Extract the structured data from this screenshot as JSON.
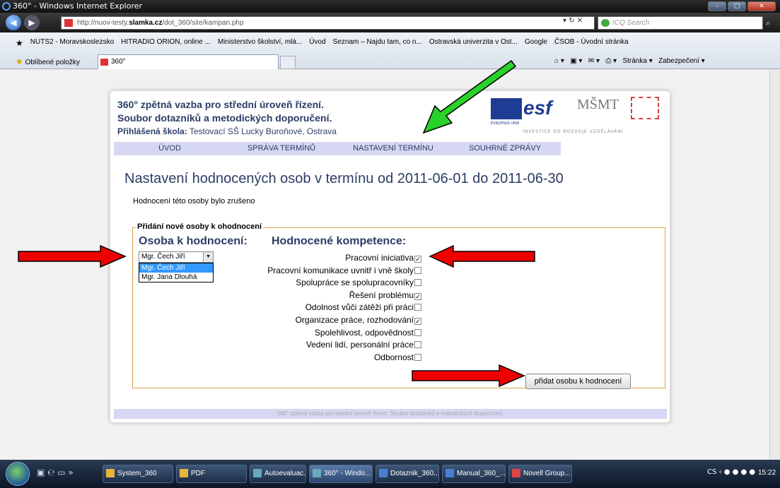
{
  "window": {
    "title": "360° - Windows Internet Explorer"
  },
  "address": {
    "pre": "http://nuov-testy.",
    "domain": "slamka.cz",
    "post": "/dot_360/site/kampan.php"
  },
  "search": {
    "placeholder": "ICQ Search"
  },
  "favorites": {
    "links": [
      "NUTS2 - Moravskoslezsko",
      "HITRADIO ORION, online ...",
      "Ministerstvo školství, mlá...",
      "Úvod",
      "Seznam – Najdu tam, co n...",
      "Ostravská univerzita v Ost...",
      "Google",
      "ČSOB - Úvodní stránka"
    ],
    "oblibene": "Oblíbené položky",
    "tab": "360°",
    "cmd_stranka": "Stránka ▾",
    "cmd_zabezpeceni": "Zabezpečení ▾"
  },
  "header": {
    "line1": "360° zpětná vazba pro střední úroveň řízení.",
    "line2": "Soubor dotazníků a metodických doporučení.",
    "school_label": "Přihlášená škola:",
    "school_name": " Testovací SŠ Lucky Buroňové, Ostrava",
    "eu_text": "EVROPSKÁ UNIE",
    "esf": "esf",
    "msmt": "MŠMT",
    "invest": "INVESTICE DO ROZVOJE VZDĚLÁVÁNÍ"
  },
  "menu": [
    "Úvod",
    "Správa termínů",
    "Nastavení termínu",
    "Souhrné zprávy"
  ],
  "main": {
    "heading": "Nastavení hodnocených osob v termínu od 2011-06-01 do 2011-06-30",
    "message": "Hodnocení této osoby bylo zrušeno",
    "legend": "Přidání nové osoby k ohodnocení",
    "osoba_title": "Osoba k hodnocení:",
    "komp_title": "Hodnocené kompetence:",
    "selected": "Mgr. Čech Jiří",
    "options": [
      "Mgr. Čech Jiří",
      "Mgr. Jana Dlouhá"
    ],
    "competences": [
      {
        "label": "Pracovní iniciativa",
        "checked": true
      },
      {
        "label": "Pracovní komunikace uvnitř i vně školy",
        "checked": false
      },
      {
        "label": "Spolupráce se spolupracovníky",
        "checked": false
      },
      {
        "label": "Řešení problému",
        "checked": true
      },
      {
        "label": "Odolnost vůči zátěži při práci",
        "checked": false
      },
      {
        "label": "Organizace práce, rozhodování",
        "checked": true
      },
      {
        "label": "Spolehlivost, odpovědnost",
        "checked": false
      },
      {
        "label": "Vedení lidí, personální práce",
        "checked": false
      },
      {
        "label": "Odbornost",
        "checked": false
      }
    ],
    "add_button": "přidat osobu k hodnocení",
    "footer": "360° zpětná vazba pro střední úroveň řízení. Soubor dotazníků a metodických doporučení."
  },
  "taskbar": {
    "items": [
      "System_360",
      "PDF",
      "Autoevaluac...",
      "360° - Windo...",
      "Dotaznik_360...",
      "Manual_360_...",
      "Novell Group..."
    ],
    "lang": "CS",
    "time": "15:22"
  }
}
